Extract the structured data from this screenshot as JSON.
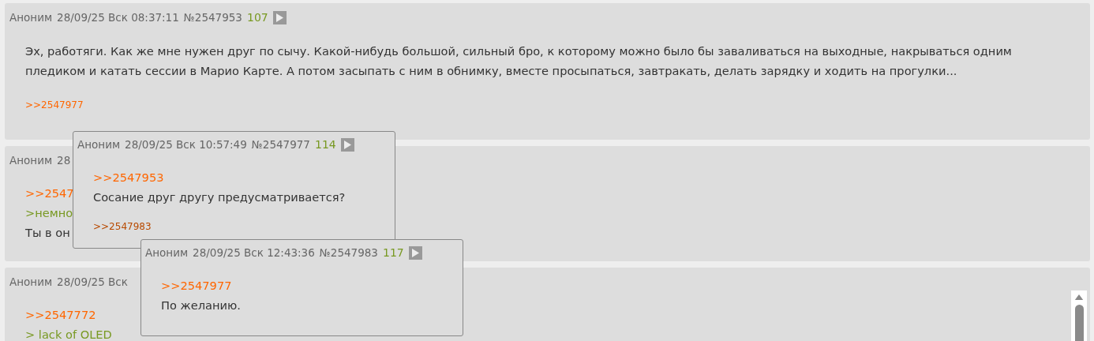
{
  "posts": [
    {
      "author": "Аноним",
      "date": "28/09/25 Вск 08:37:11",
      "number": "№2547953",
      "count": "107",
      "body": [
        {
          "kind": "text",
          "text": "Эх, работяги. Как же мне нужен друг по сычу. Какой-нибудь большой, сильный бро, к которому можно было бы заваливаться на выходные, накрываться одним пледиком и катать сессии в Марио Карте. А потом засыпать с ним в обнимку, вместе просыпаться, завтракать, делать зарядку и ходить на прогулки..."
        }
      ],
      "replies": [
        {
          "text": ">>2547977",
          "highlighted": false
        }
      ]
    },
    {
      "author": "Аноним",
      "date": "28",
      "body": [
        {
          "kind": "link",
          "text": ">>2547"
        },
        {
          "kind": "quote",
          "text": ">немно"
        },
        {
          "kind": "text",
          "text": "Ты в он"
        }
      ]
    },
    {
      "author": "Аноним",
      "date": "28/09/25 Вск",
      "body": [
        {
          "kind": "link",
          "text": ">>2547772"
        },
        {
          "kind": "quote",
          "text": "> lack of OLED"
        }
      ]
    }
  ],
  "popups": [
    {
      "author": "Аноним",
      "date": "28/09/25 Вск 10:57:49",
      "number": "№2547977",
      "count": "114",
      "body": [
        {
          "kind": "link",
          "text": ">>2547953"
        },
        {
          "kind": "text",
          "text": "Сосание друг другу предусматривается?"
        }
      ],
      "replies": [
        {
          "text": ">>2547983",
          "highlighted": true
        }
      ]
    },
    {
      "author": "Аноним",
      "date": "28/09/25 Вск 12:43:36",
      "number": "№2547983",
      "count": "117",
      "body": [
        {
          "kind": "link",
          "text": ">>2547977"
        },
        {
          "kind": "text",
          "text": "По желанию."
        }
      ]
    }
  ]
}
